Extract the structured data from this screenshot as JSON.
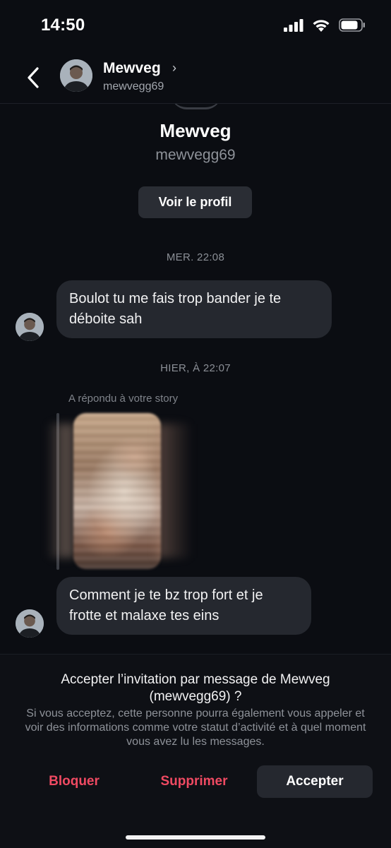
{
  "status_bar": {
    "time": "14:50"
  },
  "header": {
    "name": "Mewveg",
    "username": "mewvegg69",
    "chevron": "›"
  },
  "profile": {
    "name": "Mewveg",
    "username": "mewvegg69",
    "view_profile_label": "Voir le profil"
  },
  "messages": [
    {
      "timestamp": "MER. 22:08",
      "text": "Boulot tu me fais trop bander je te déboite sah"
    },
    {
      "timestamp": "HIER, À 22:07",
      "reply_label": "A répondu à votre story",
      "text": "Comment je te bz trop fort et je frotte et malaxe tes eins"
    }
  ],
  "invite": {
    "title": "Accepter l’invitation par message de Mewveg (mewvegg69) ?",
    "description": "Si vous acceptez, cette personne pourra également vous appeler et voir des informations comme votre statut d’activité et à quel moment vous avez lu les messages.",
    "block_label": "Bloquer",
    "delete_label": "Supprimer",
    "accept_label": "Accepter"
  },
  "colors": {
    "background": "#0b0d12",
    "bubble": "#25282f",
    "danger": "#ef4a62"
  },
  "icons": [
    "signal-icon",
    "wifi-icon",
    "battery-icon",
    "back-icon",
    "avatar-icon"
  ]
}
